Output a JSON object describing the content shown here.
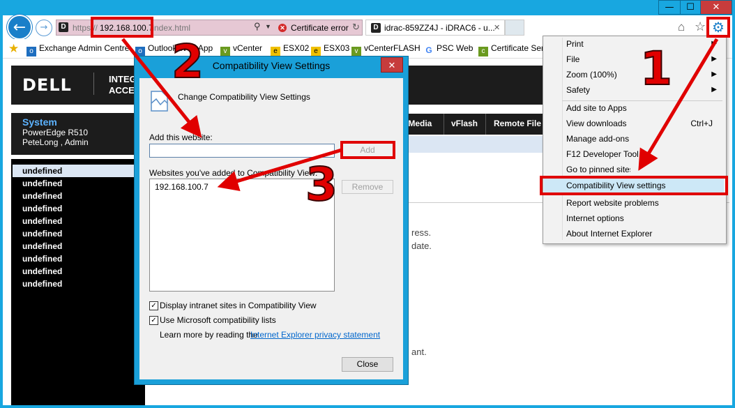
{
  "browser": {
    "window_controls": {
      "minimize": "—",
      "maximize": "☐",
      "close": "✕"
    },
    "address": {
      "scheme": "https://",
      "host": "192.168.100.7",
      "path": "/index.html",
      "cert_error": "Certificate error"
    },
    "tab_active": {
      "title": "idrac-859ZZ4J - iDRAC6 - u...",
      "close": "✕"
    },
    "favorites": [
      "Exchange Admin Centre",
      "Outlook Web App",
      "vCenter",
      "ESX02",
      "ESX03",
      "vCenterFLASH",
      "PSC Web",
      "Certificate Ser"
    ]
  },
  "page": {
    "logo": "DELL",
    "brand_lines": [
      "INTEG",
      "ACCE"
    ],
    "system": {
      "title": "System",
      "model": "PowerEdge R510",
      "user": "PeteLong , Admin"
    },
    "nav_items": [
      "undefined",
      "undefined",
      "undefined",
      "undefined",
      "undefined",
      "undefined",
      "undefined",
      "undefined",
      "undefined",
      "undefined"
    ],
    "tabs": [
      "/Media",
      "vFlash",
      "Remote File"
    ],
    "fragments": [
      "ress.",
      "date.",
      "ant."
    ]
  },
  "menu": {
    "items_top": [
      {
        "label": "Print",
        "arrow": "▶"
      },
      {
        "label": "File",
        "arrow": "▶"
      },
      {
        "label": "Zoom (100%)",
        "arrow": "▶"
      },
      {
        "label": "Safety",
        "arrow": "▶"
      }
    ],
    "add_site": "Add site to Apps",
    "view_downloads": "View downloads",
    "view_downloads_shortcut": "Ctrl+J",
    "manage_addons": "Manage add-ons",
    "f12": "F12 Developer Tools",
    "pinned": "Go to pinned sites",
    "compat": "Compatibility View settings",
    "report": "Report website problems",
    "internet_options": "Internet options",
    "about": "About Internet Explorer"
  },
  "dialog": {
    "title": "Compatibility View Settings",
    "close": "✕",
    "heading": "Change Compatibility View Settings",
    "add_label": "Add this website:",
    "add_value": "",
    "add_button": "Add",
    "list_label": "Websites you've added to Compatibility View:",
    "list_items": [
      "192.168.100.7"
    ],
    "remove_button": "Remove",
    "chk_intranet": "Display intranet sites in Compatibility View",
    "chk_ms_lists": "Use Microsoft compatibility lists",
    "learn_more": "Learn more by reading the",
    "privacy_link": "Internet Explorer privacy statement",
    "close_button": "Close"
  },
  "annotations": {
    "step1": "1",
    "step2": "2",
    "step3": "3",
    "color": "#e00000"
  }
}
